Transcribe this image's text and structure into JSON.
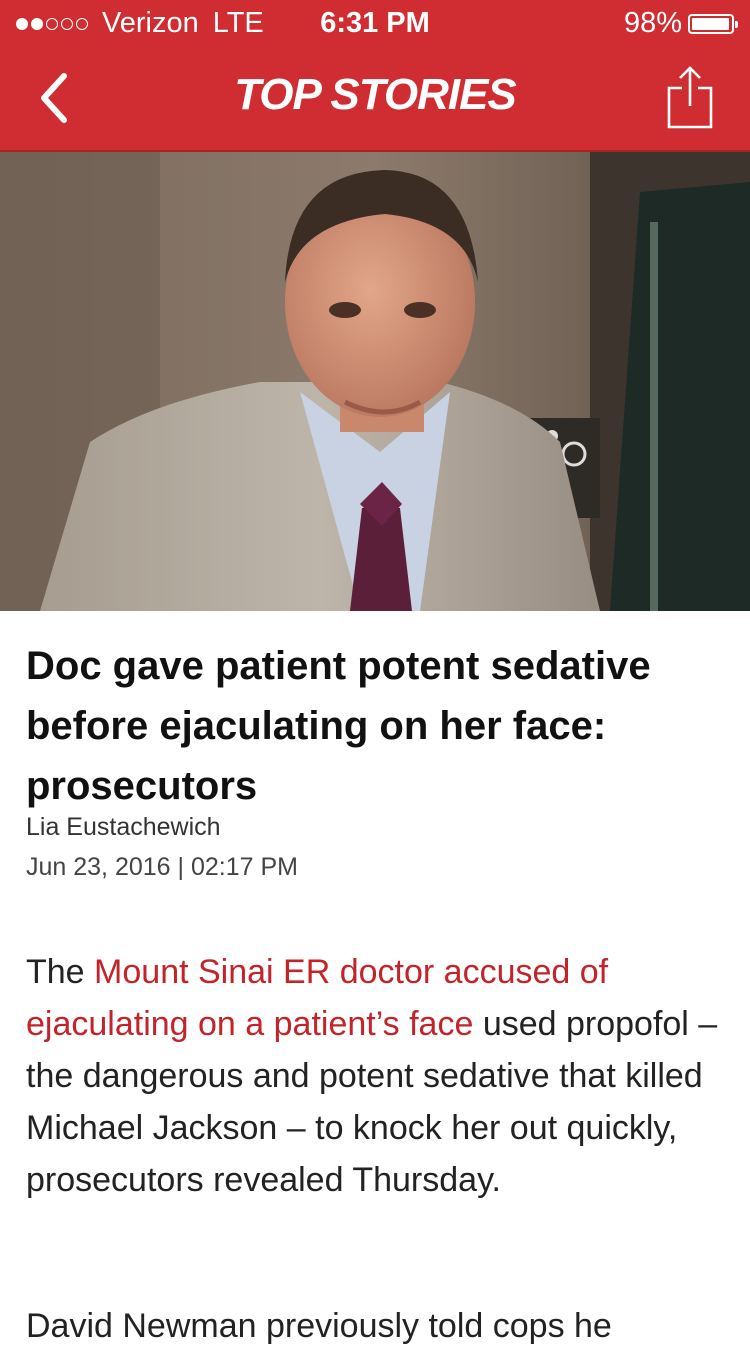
{
  "status_bar": {
    "carrier": "Verizon",
    "network": "LTE",
    "time": "6:31 PM",
    "battery": "98%",
    "battery_level": 0.98,
    "signal_bars_filled": 2,
    "signal_bars_total": 5
  },
  "nav": {
    "title": "TOP STORIES",
    "back_icon": "chevron-left-icon",
    "share_icon": "share-icon"
  },
  "article": {
    "headline": "Doc gave patient potent sedative before ejaculating on her face: prosecutors",
    "author": "Lia Eustachewich",
    "date": "Jun 23, 2016 | 02:17 PM",
    "body_before_link": "The ",
    "body_link": "Mount Sinai ER doctor accused of ejaculating on a patient’s face",
    "body_after_link": " used propofol – the dangerous and potent sedative that killed Michael Jackson – to knock her out quickly, prosecutors revealed Thursday.",
    "next_paragraph_start": "David Newman previously told cops he"
  },
  "colors": {
    "brand_red": "#cf2d31",
    "link_red": "#c3242a"
  }
}
